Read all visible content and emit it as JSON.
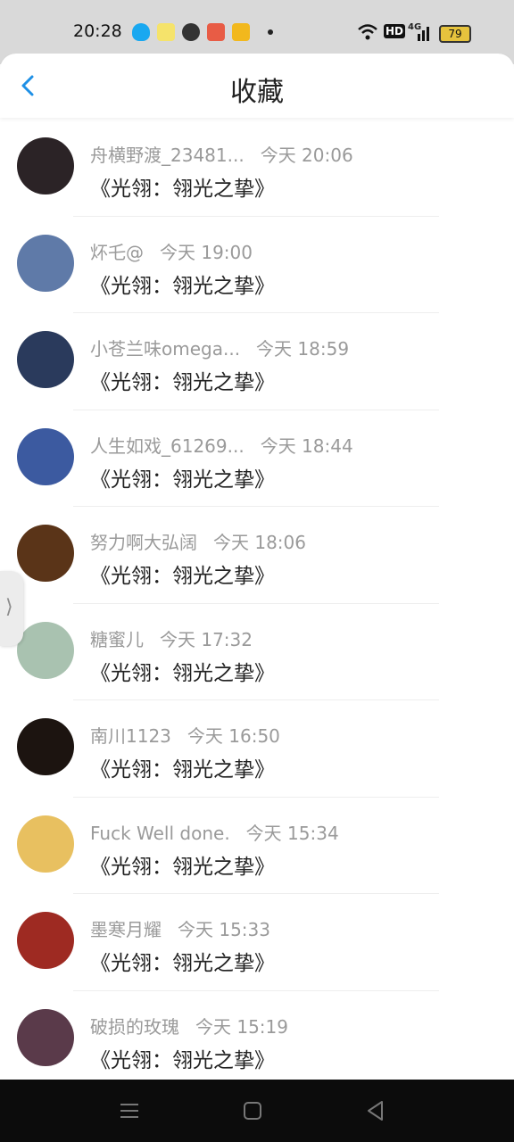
{
  "status_bar": {
    "time": "20:28",
    "network": "HD",
    "signal": "4G",
    "battery": "79"
  },
  "header": {
    "title": "收藏"
  },
  "items": [
    {
      "name": "舟横野渡_23481...",
      "time": "今天 20:06",
      "work": "《光翎：翎光之挚》",
      "avatar_color": "#2b2326"
    },
    {
      "name": "炋乇@",
      "time": "今天 19:00",
      "work": "《光翎：翎光之挚》",
      "avatar_color": "#5f7aa8"
    },
    {
      "name": "小苍兰味omega...",
      "time": "今天 18:59",
      "work": "《光翎：翎光之挚》",
      "avatar_color": "#2a3a5c"
    },
    {
      "name": "人生如戏_61269...",
      "time": "今天 18:44",
      "work": "《光翎：翎光之挚》",
      "avatar_color": "#3c5aa0"
    },
    {
      "name": "努力啊大弘阔",
      "time": "今天 18:06",
      "work": "《光翎：翎光之挚》",
      "avatar_color": "#5a3418"
    },
    {
      "name": "糖蜜儿",
      "time": "今天 17:32",
      "work": "《光翎：翎光之挚》",
      "avatar_color": "#a9c2b0"
    },
    {
      "name": "南川1123",
      "time": "今天 16:50",
      "work": "《光翎：翎光之挚》",
      "avatar_color": "#1c1410"
    },
    {
      "name": "Fuck Well done.",
      "time": "今天 15:34",
      "work": "《光翎：翎光之挚》",
      "avatar_color": "#e8c060"
    },
    {
      "name": "墨寒月耀",
      "time": "今天 15:33",
      "work": "《光翎：翎光之挚》",
      "avatar_color": "#9e2a22"
    },
    {
      "name": "破损的玫瑰",
      "time": "今天 15:19",
      "work": "《光翎：翎光之挚》",
      "avatar_color": "#5a3a4a"
    }
  ],
  "accent": "#1e90e6"
}
